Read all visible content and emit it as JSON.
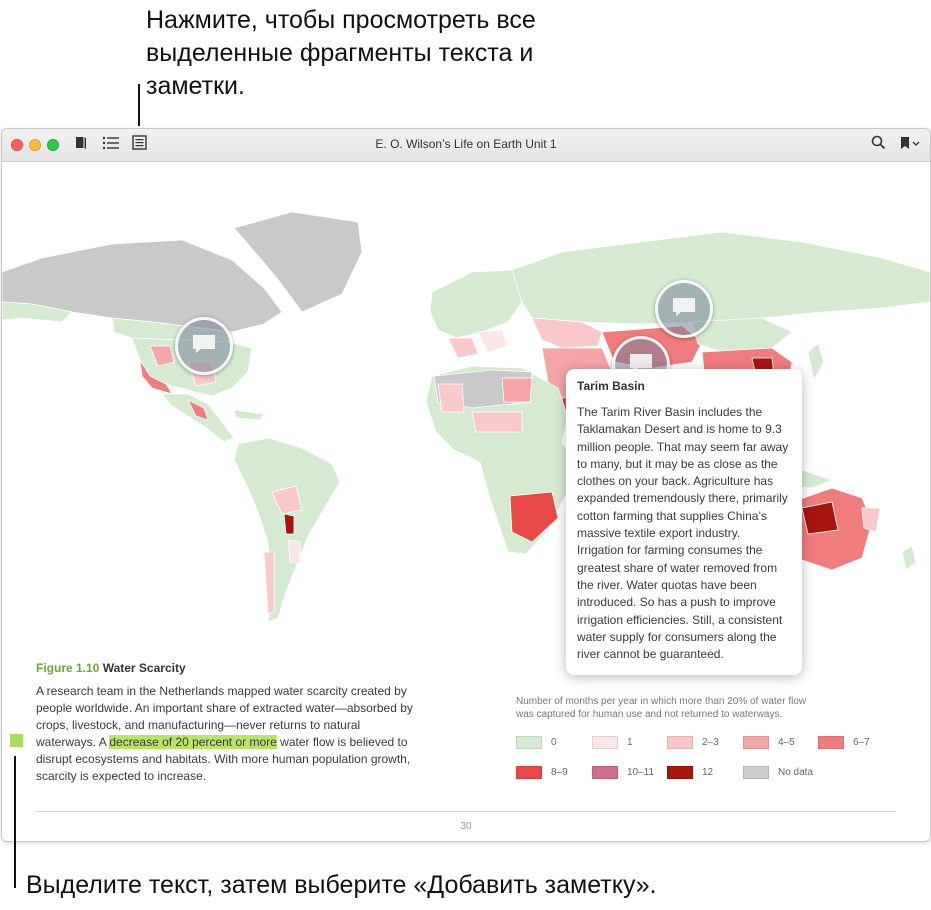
{
  "callouts": {
    "top": "Нажмите, чтобы просмотреть все выделенные фрагменты текста и заметки.",
    "bottom": "Выделите текст, затем выберите «Добавить заметку»."
  },
  "window": {
    "title": "E. O. Wilson’s Life on Earth Unit 1",
    "toolbar": {
      "library_icon": "book-icon",
      "toc_icon": "list-icon",
      "notes_icon": "notes-icon",
      "search_icon": "search-icon",
      "bookmark_icon": "bookmark-icon"
    }
  },
  "figure": {
    "number": "Figure 1.10",
    "title": "Water Scarcity",
    "text_before": "A research team in the Netherlands mapped water scarcity created by people worldwide. An important share of extracted water—absorbed by crops, livestock, and manufacturing—never returns to natural waterways. A ",
    "highlight": "decrease of 20 percent or more",
    "text_after": " water flow is believed to disrupt ecosystems and habitats. With more human population growth, scarcity is expected to increase."
  },
  "popover": {
    "title": "Tarim Basin",
    "body": "The Tarim River Basin includes the Taklamakan Desert and is home to 9.3 million people. That may seem far away to many, but it may be as close as the clothes on your back. Agriculture has expanded tremendously there, primarily cotton farming that supplies China’s massive textile export industry. Irrigation for farming consumes the greatest share of water removed from the river. Water quotas have been introduced. So has a push to improve irrigation efficiencies. Still, a consistent water supply for consumers along the river cannot be guaranteed."
  },
  "legend": {
    "title": "Number of months per year in which more than 20% of water flow was captured for human use and not returned to waterways.",
    "items": [
      {
        "label": "0",
        "color": "#d6ead2"
      },
      {
        "label": "1",
        "color": "#fbe6e8"
      },
      {
        "label": "2–3",
        "color": "#f8c8cb"
      },
      {
        "label": "4–5",
        "color": "#f4a5a6"
      },
      {
        "label": "6–7",
        "color": "#f07d7e"
      },
      {
        "label": "8–9",
        "color": "#e84848"
      },
      {
        "label": "10–11",
        "color": "#cf6d8c"
      },
      {
        "label": "12",
        "color": "#a61510"
      },
      {
        "label": "No data",
        "color": "#cccccc"
      }
    ]
  },
  "page": {
    "number": "30"
  }
}
